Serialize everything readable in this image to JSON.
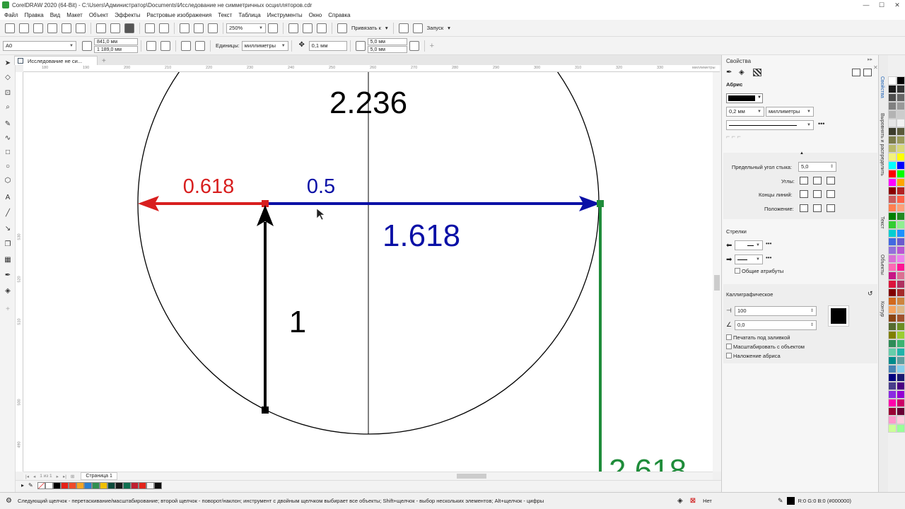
{
  "window": {
    "title": "CorelDRAW 2020 (64-Bit) - C:\\Users\\Администратор\\Documents\\Исследование не симметричных осцилляторов.cdr",
    "minimize": "—",
    "maximize": "☐",
    "close": "✕"
  },
  "menu": {
    "items": [
      "Файл",
      "Правка",
      "Вид",
      "Макет",
      "Объект",
      "Эффекты",
      "Растровые изображения",
      "Текст",
      "Таблица",
      "Инструменты",
      "Окно",
      "Справка"
    ]
  },
  "toolbar": {
    "zoom": "250%",
    "snap_label": "Привязать к",
    "launch_label": "Запуск"
  },
  "propbar": {
    "page_size": "A0",
    "width": "841,0 мм",
    "height": "1 189,0 мм",
    "units_label": "Единицы:",
    "units": "миллиметры",
    "nudge": "0,1 мм",
    "dup_x": "5,0 мм",
    "dup_y": "5,0 мм"
  },
  "doc_tab": {
    "label": "Исследование не си..."
  },
  "ruler": {
    "top_ticks": [
      "180",
      "190",
      "200",
      "210",
      "220",
      "230",
      "240",
      "250",
      "260",
      "270",
      "280",
      "290",
      "300",
      "310",
      "320",
      "330"
    ],
    "unit": "миллиметры",
    "left_ticks": [
      "530",
      "520",
      "510",
      "500",
      "490"
    ]
  },
  "drawing": {
    "label_top": "2.236",
    "label_red": "0.618",
    "label_half": "0.5",
    "label_blue": "1.618",
    "label_one": "1",
    "label_green": "2.618",
    "colors": {
      "red": "#d81e1e",
      "blue": "#0a10a6",
      "green": "#1f8c3a",
      "black": "#000000"
    }
  },
  "pagebar": {
    "page_of": "1 из 1",
    "page_tab": "Страница 1"
  },
  "status": {
    "hint": "Следующий щелчок - перетаскивание/масштабирование; второй щелчок - поворот/наклон; инструмент с двойным щелчком выбирает все объекты; Shift+щелчок - выбор нескольких элементов; Alt+щелчок - цифры",
    "fill": "Нет",
    "outline_color": "R:0 G:0 B:0 (#000000)"
  },
  "docker": {
    "title": "Свойства",
    "outline_section": "Абрис",
    "outline_width": "0,2 мм",
    "outline_units": "миллиметры",
    "miter_label": "Предельный угол стыка:",
    "miter_value": "5,0",
    "corners_label": "Углы:",
    "caps_label": "Концы линий:",
    "position_label": "Положение:",
    "arrows_section": "Стрелки",
    "shared_attrs": "Общие атрибуты",
    "calligraphic_section": "Каллиграфическое",
    "stretch": "100",
    "angle": "0,0",
    "behind_fill": "Печатать под заливкой",
    "scale_with": "Масштабировать с объектом",
    "overprint": "Наложение абриса"
  },
  "side_tabs": [
    "Свойства",
    "Выровнять и распределить",
    "Текст",
    "Объекты",
    "Контур"
  ],
  "palette_colors": [
    "#ffffff",
    "#000000",
    "#1a1a1a",
    "#333333",
    "#4d4d4d",
    "#666666",
    "#808080",
    "#999999",
    "#b3b3b3",
    "#cccccc",
    "#e6e6e6",
    "#f2f2f2",
    "#3b3b2b",
    "#5a5a3a",
    "#7a7a4a",
    "#9a9a5a",
    "#b9b96a",
    "#d8d87a",
    "#f3f37a",
    "#ffff00",
    "#00ffff",
    "#0000ff",
    "#ff0000",
    "#00ff00",
    "#ff00ff",
    "#ffa500",
    "#8b0000",
    "#b22222",
    "#cd5c5c",
    "#ff6347",
    "#ff7f50",
    "#ffa07a",
    "#008000",
    "#228b22",
    "#32cd32",
    "#90ee90",
    "#00ced1",
    "#1e90ff",
    "#4169e1",
    "#6a5acd",
    "#9370db",
    "#ba55d3",
    "#da70d6",
    "#ee82ee",
    "#ff69b4",
    "#ff1493",
    "#c71585",
    "#db7093",
    "#dc143c",
    "#b03060",
    "#800000",
    "#a52a2a",
    "#d2691e",
    "#cd853f",
    "#f4a460",
    "#deb887",
    "#8b4513",
    "#a0522d",
    "#556b2f",
    "#6b8e23",
    "#808000",
    "#9acd32",
    "#2e8b57",
    "#3cb371",
    "#66cdaa",
    "#20b2aa",
    "#008b8b",
    "#5f9ea0",
    "#4682b4",
    "#87ceeb",
    "#000080",
    "#191970",
    "#483d8b",
    "#4b0082",
    "#8a2be2",
    "#9400d3",
    "#ff00aa",
    "#cc0066",
    "#990033",
    "#660033",
    "#ff99cc",
    "#ffccdd",
    "#ccff99",
    "#99ff99"
  ],
  "doc_palette": [
    "#ffffff",
    "#000000",
    "#e62117",
    "#ef4a2a",
    "#f5a623",
    "#2a7fd0",
    "#2f8f4f",
    "#f0c000",
    "#0c4a3a",
    "#1a1a1a",
    "#0f6f4f",
    "#c01f2f",
    "#e3241b",
    "#f6f6f6",
    "#101010",
    "#0a2fd8"
  ]
}
